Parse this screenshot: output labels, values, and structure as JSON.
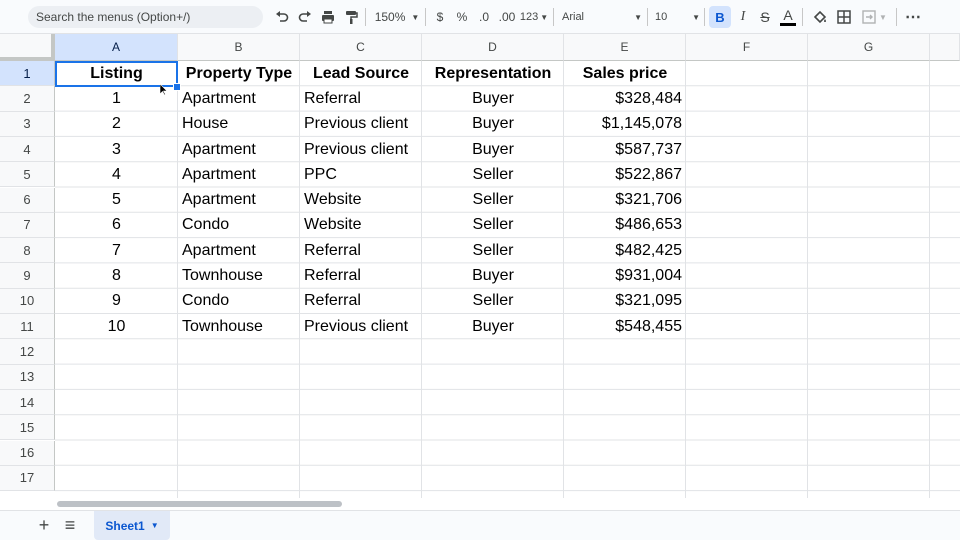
{
  "toolbar": {
    "search_placeholder": "Search the menus (Option+/)",
    "zoom": "150%",
    "currency": "$",
    "percent": "%",
    "dec_decrease": ".0",
    "dec_increase": ".00",
    "number_format": "123",
    "font": "Arial",
    "font_size": "10",
    "bold": "B",
    "italic": "I",
    "strike": "S",
    "text_color": "A",
    "more": "⋯",
    "accent_color": "#0b57d0"
  },
  "grid": {
    "columns": [
      "A",
      "B",
      "C",
      "D",
      "E",
      "F",
      "G"
    ],
    "rows": [
      "1",
      "2",
      "3",
      "4",
      "5",
      "6",
      "7",
      "8",
      "9",
      "10",
      "11",
      "12",
      "13",
      "14",
      "15",
      "16",
      "17"
    ],
    "headers": [
      "Listing",
      "Property Type",
      "Lead Source",
      "Representation",
      "Sales price"
    ],
    "data": [
      [
        "1",
        "Apartment",
        "Referral",
        "Buyer",
        "$328,484"
      ],
      [
        "2",
        "House",
        "Previous client",
        "Buyer",
        "$1,145,078"
      ],
      [
        "3",
        "Apartment",
        "Previous client",
        "Buyer",
        "$587,737"
      ],
      [
        "4",
        "Apartment",
        "PPC",
        "Seller",
        "$522,867"
      ],
      [
        "5",
        "Apartment",
        "Website",
        "Seller",
        "$321,706"
      ],
      [
        "6",
        "Condo",
        "Website",
        "Seller",
        "$486,653"
      ],
      [
        "7",
        "Apartment",
        "Referral",
        "Seller",
        "$482,425"
      ],
      [
        "8",
        "Townhouse",
        "Referral",
        "Buyer",
        "$931,004"
      ],
      [
        "9",
        "Condo",
        "Referral",
        "Seller",
        "$321,095"
      ],
      [
        "10",
        "Townhouse",
        "Previous client",
        "Buyer",
        "$548,455"
      ]
    ]
  },
  "sheets": {
    "add_icon": "+",
    "list_icon": "≡",
    "active": "Sheet1"
  }
}
